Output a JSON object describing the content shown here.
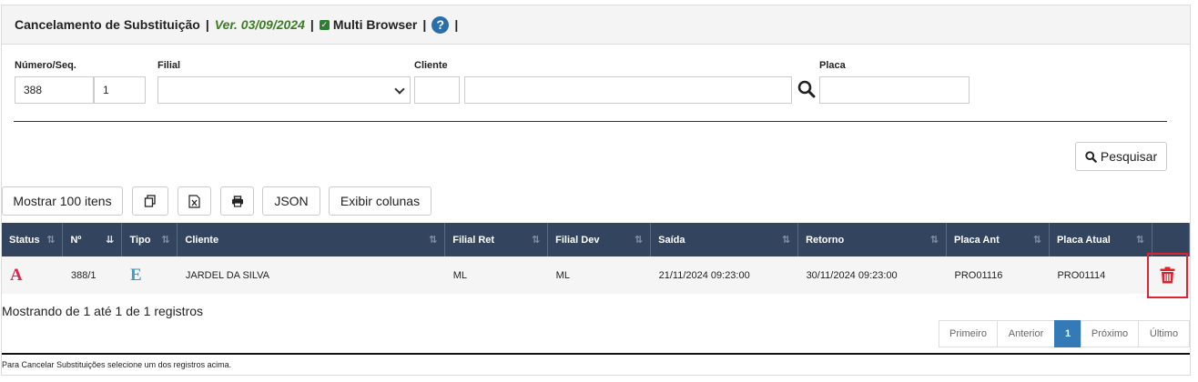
{
  "header": {
    "title": "Cancelamento de Substituição",
    "version": "Ver. 03/09/2024",
    "multi_browser": "Multi Browser",
    "separator": "|"
  },
  "filters": {
    "numero_label": "Número/Seq.",
    "numero_value": "388",
    "seq_value": "1",
    "filial_label": "Filial",
    "filial_value": "",
    "cliente_label": "Cliente",
    "cliente_code": "",
    "cliente_name": "",
    "placa_label": "Placa",
    "placa_value": ""
  },
  "search_button": "Pesquisar",
  "toolbar": {
    "show_label": "Mostrar 100 itens",
    "json_label": "JSON",
    "columns_label": "Exibir colunas"
  },
  "table": {
    "columns": [
      "Status",
      "Nº",
      "Tipo",
      "Cliente",
      "Filial Ret",
      "Filial Dev",
      "Saída",
      "Retorno",
      "Placa Ant",
      "Placa Atual"
    ],
    "rows": [
      {
        "status": "A",
        "numero": "388/1",
        "tipo": "E",
        "cliente": "JARDEL DA SILVA",
        "filial_ret": "ML",
        "filial_dev": "ML",
        "saida": "21/11/2024 09:23:00",
        "retorno": "30/11/2024 09:23:00",
        "placa_ant": "PRO01116",
        "placa_atual": "PRO01114"
      }
    ]
  },
  "info_text": "Mostrando de 1 até 1 de 1 registros",
  "pagination": {
    "first": "Primeiro",
    "prev": "Anterior",
    "current": "1",
    "next": "Próximo",
    "last": "Último"
  },
  "footer_text": "Para Cancelar Substituições selecione um dos registros acima.",
  "colors": {
    "header_bg": "#33455e",
    "status_red": "#d9264d",
    "tipo_blue": "#39a0c9",
    "delete_red": "#e0242f",
    "version_green": "#3b7d23",
    "active_page": "#337ab7"
  }
}
